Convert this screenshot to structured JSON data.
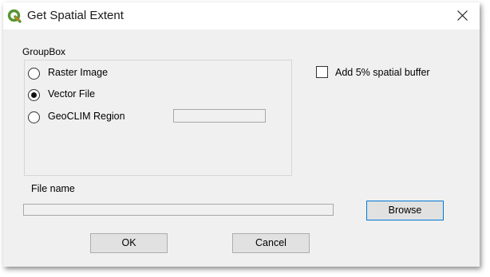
{
  "window": {
    "title": "Get Spatial Extent",
    "app_icon": "qgis-logo-icon",
    "close_icon": "close-icon",
    "accent_color": "#589632"
  },
  "groupbox": {
    "title": "GroupBox",
    "options": [
      {
        "label": "Raster Image",
        "checked": false
      },
      {
        "label": "Vector File",
        "checked": true
      },
      {
        "label": "GeoCLIM Region",
        "checked": false
      }
    ],
    "region_value": ""
  },
  "buffer_checkbox": {
    "label": "Add 5% spatial buffer",
    "checked": false
  },
  "file": {
    "label": "File name",
    "value": "",
    "browse_label": "Browse"
  },
  "buttons": {
    "ok_label": "OK",
    "cancel_label": "Cancel"
  }
}
